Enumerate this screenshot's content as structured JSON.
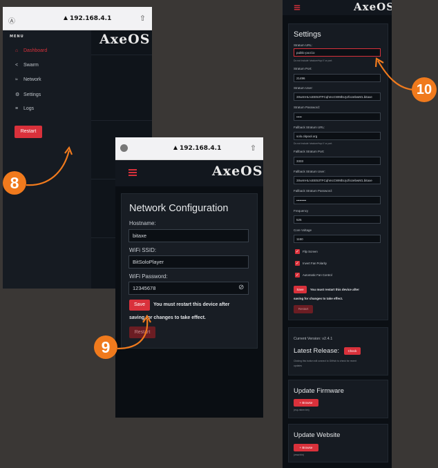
{
  "panel8": {
    "url": "192.168.4.1",
    "logo": "AxeOS",
    "menu_title": "MENU",
    "items": [
      {
        "label": "Dashboard",
        "icon": "home-icon",
        "glyph": "⌂"
      },
      {
        "label": "Swarm",
        "icon": "share-icon",
        "glyph": "<"
      },
      {
        "label": "Network",
        "icon": "wifi-icon",
        "glyph": "≈"
      },
      {
        "label": "Settings",
        "icon": "gear-icon",
        "glyph": "⚙"
      },
      {
        "label": "Logs",
        "icon": "list-icon",
        "glyph": "≡"
      }
    ],
    "restart_label": "Restart",
    "badge": "8"
  },
  "panel9": {
    "url": "192.168.4.1",
    "logo": "AxeOS",
    "title": "Network Configuration",
    "hostname_label": "Hostname:",
    "hostname_value": "bitaxe",
    "ssid_label": "WiFi SSID:",
    "ssid_value": "BitSoloPlayer",
    "password_label": "WiFi Password:",
    "password_value": "12345678",
    "save_label": "Save",
    "notice_line1": "You must restart this device after",
    "notice_line2": "saving for changes to take effect.",
    "restart_label": "Restart",
    "badge": "9"
  },
  "panel10": {
    "logo": "AxeOS",
    "settings_title": "Settings",
    "fields": [
      {
        "label": "Stratum URL:",
        "value": "public-pool.io",
        "hint": "Do not include 'stratum+tcp://' or port."
      },
      {
        "label": "Stratum Port:",
        "value": "21496"
      },
      {
        "label": "Stratum User:",
        "value": "3SwmHLncEE53TFCqhmcCWMbUyJfxUebwM1.bitaxe"
      },
      {
        "label": "Stratum Password:",
        "value": "•••••"
      },
      {
        "label": "Fallback Stratum URL:",
        "value": "solo.ckpool.org",
        "hint": "Do not include 'stratum+tcp://' or port."
      },
      {
        "label": "Fallback Stratum Port:",
        "value": "3333"
      },
      {
        "label": "Fallback Stratum User:",
        "value": "3SwmHLncEE53TFCqhmcCWMbUyJfxUebwM1.bitaxe"
      },
      {
        "label": "Fallback Stratum Password:",
        "value": "•••••••••"
      },
      {
        "label": "Frequency",
        "value": "525"
      },
      {
        "label": "Core Voltage",
        "value": "1150"
      }
    ],
    "checkboxes": [
      "Flip Screen",
      "Invert Fan Polarity",
      "Automatic Fan Control"
    ],
    "save_label": "Save",
    "notice_line1": "You must restart this device after",
    "notice_line2": "saving for changes to take effect.",
    "restart_label": "Restart",
    "version_text": "Current Version: v2.4.1",
    "latest_release_label": "Latest Release:",
    "check_label": "Check",
    "check_hint_line1": "Clicking this button will connect to GitHub to check for recent",
    "check_hint_line2": "updates",
    "update_firmware_title": "Update Firmware",
    "browse_label": "+ Browse",
    "firmware_hint": "(esp-miner.bin)",
    "update_website_title": "Update Website",
    "website_hint": "(www.bin)",
    "badge": "10"
  },
  "colors": {
    "accent": "#d9313b",
    "badge": "#f07a1d",
    "background": "#3a3735",
    "panel": "#0d1218"
  }
}
